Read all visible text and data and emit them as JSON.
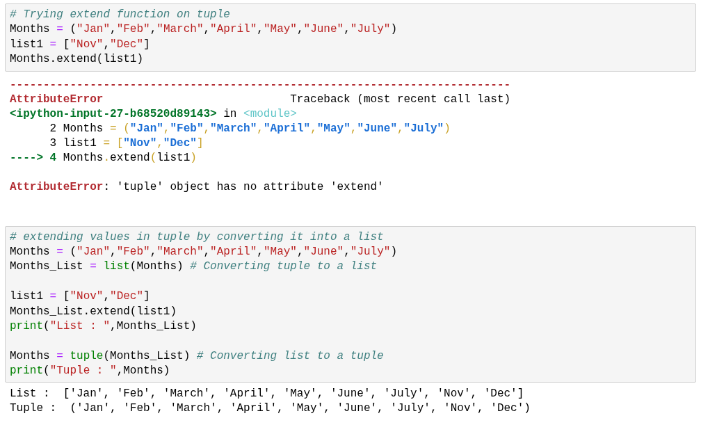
{
  "cells": [
    {
      "kind": "code",
      "lines": [
        {
          "kind": "text",
          "tokens": [
            {
              "kind": "comment",
              "text": "# Trying extend function on tuple"
            }
          ]
        },
        {
          "kind": "text",
          "tokens": [
            {
              "kind": "plain",
              "text": "Months "
            },
            {
              "kind": "operator",
              "text": "="
            },
            {
              "kind": "plain",
              "text": " ("
            },
            {
              "kind": "string",
              "text": "\"Jan\""
            },
            {
              "kind": "plain",
              "text": ","
            },
            {
              "kind": "string",
              "text": "\"Feb\""
            },
            {
              "kind": "plain",
              "text": ","
            },
            {
              "kind": "string",
              "text": "\"March\""
            },
            {
              "kind": "plain",
              "text": ","
            },
            {
              "kind": "string",
              "text": "\"April\""
            },
            {
              "kind": "plain",
              "text": ","
            },
            {
              "kind": "string",
              "text": "\"May\""
            },
            {
              "kind": "plain",
              "text": ","
            },
            {
              "kind": "string",
              "text": "\"June\""
            },
            {
              "kind": "plain",
              "text": ","
            },
            {
              "kind": "string",
              "text": "\"July\""
            },
            {
              "kind": "plain",
              "text": ")"
            }
          ]
        },
        {
          "kind": "text",
          "tokens": [
            {
              "kind": "plain",
              "text": "list1 "
            },
            {
              "kind": "operator",
              "text": "="
            },
            {
              "kind": "plain",
              "text": " ["
            },
            {
              "kind": "string",
              "text": "\"Nov\""
            },
            {
              "kind": "plain",
              "text": ","
            },
            {
              "kind": "string",
              "text": "\"Dec\""
            },
            {
              "kind": "plain",
              "text": "]"
            }
          ]
        },
        {
          "kind": "text",
          "tokens": [
            {
              "kind": "plain",
              "text": "Months.extend(list1)"
            }
          ]
        }
      ]
    },
    {
      "kind": "error",
      "lines": [
        {
          "kind": "text",
          "tokens": [
            {
              "kind": "error-name",
              "text": "---------------------------------------------------------------------------"
            }
          ]
        },
        {
          "kind": "text",
          "tokens": [
            {
              "kind": "error-name",
              "text": "AttributeError"
            },
            {
              "kind": "plain",
              "text": "                            Traceback (most recent call last)"
            }
          ]
        },
        {
          "kind": "text",
          "tokens": [
            {
              "kind": "file",
              "text": "<ipython-input-27-b68520d89143>"
            },
            {
              "kind": "plain",
              "text": " in "
            },
            {
              "kind": "module",
              "text": "<module>"
            }
          ]
        },
        {
          "kind": "text",
          "tokens": [
            {
              "kind": "plain",
              "text": "      2 Months "
            },
            {
              "kind": "tb-punct",
              "text": "= "
            },
            {
              "kind": "tb-punct",
              "text": "("
            },
            {
              "kind": "tb-string",
              "text": "\"Jan\""
            },
            {
              "kind": "tb-punct",
              "text": ","
            },
            {
              "kind": "tb-string",
              "text": "\"Feb\""
            },
            {
              "kind": "tb-punct",
              "text": ","
            },
            {
              "kind": "tb-string",
              "text": "\"March\""
            },
            {
              "kind": "tb-punct",
              "text": ","
            },
            {
              "kind": "tb-string",
              "text": "\"April\""
            },
            {
              "kind": "tb-punct",
              "text": ","
            },
            {
              "kind": "tb-string",
              "text": "\"May\""
            },
            {
              "kind": "tb-punct",
              "text": ","
            },
            {
              "kind": "tb-string",
              "text": "\"June\""
            },
            {
              "kind": "tb-punct",
              "text": ","
            },
            {
              "kind": "tb-string",
              "text": "\"July\""
            },
            {
              "kind": "tb-punct",
              "text": ")"
            }
          ]
        },
        {
          "kind": "text",
          "tokens": [
            {
              "kind": "plain",
              "text": "      3 list1 "
            },
            {
              "kind": "tb-punct",
              "text": "= "
            },
            {
              "kind": "tb-punct",
              "text": "["
            },
            {
              "kind": "tb-string",
              "text": "\"Nov\""
            },
            {
              "kind": "tb-punct",
              "text": ","
            },
            {
              "kind": "tb-string",
              "text": "\"Dec\""
            },
            {
              "kind": "tb-punct",
              "text": "]"
            }
          ]
        },
        {
          "kind": "text",
          "tokens": [
            {
              "kind": "file",
              "text": "----> 4"
            },
            {
              "kind": "plain",
              "text": " Months"
            },
            {
              "kind": "tb-punct",
              "text": "."
            },
            {
              "kind": "plain",
              "text": "extend"
            },
            {
              "kind": "tb-punct",
              "text": "("
            },
            {
              "kind": "plain",
              "text": "list1"
            },
            {
              "kind": "tb-punct",
              "text": ")"
            }
          ]
        },
        {
          "kind": "blank"
        },
        {
          "kind": "text",
          "tokens": [
            {
              "kind": "error-name",
              "text": "AttributeError"
            },
            {
              "kind": "plain",
              "text": ": 'tuple' object has no attribute 'extend'"
            }
          ]
        }
      ]
    },
    {
      "kind": "code",
      "lines": [
        {
          "kind": "text",
          "tokens": [
            {
              "kind": "comment",
              "text": "# extending values in tuple by converting it into a list"
            }
          ]
        },
        {
          "kind": "text",
          "tokens": [
            {
              "kind": "plain",
              "text": "Months "
            },
            {
              "kind": "operator",
              "text": "="
            },
            {
              "kind": "plain",
              "text": " ("
            },
            {
              "kind": "string",
              "text": "\"Jan\""
            },
            {
              "kind": "plain",
              "text": ","
            },
            {
              "kind": "string",
              "text": "\"Feb\""
            },
            {
              "kind": "plain",
              "text": ","
            },
            {
              "kind": "string",
              "text": "\"March\""
            },
            {
              "kind": "plain",
              "text": ","
            },
            {
              "kind": "string",
              "text": "\"April\""
            },
            {
              "kind": "plain",
              "text": ","
            },
            {
              "kind": "string",
              "text": "\"May\""
            },
            {
              "kind": "plain",
              "text": ","
            },
            {
              "kind": "string",
              "text": "\"June\""
            },
            {
              "kind": "plain",
              "text": ","
            },
            {
              "kind": "string",
              "text": "\"July\""
            },
            {
              "kind": "plain",
              "text": ")"
            }
          ]
        },
        {
          "kind": "text",
          "tokens": [
            {
              "kind": "plain",
              "text": "Months_List "
            },
            {
              "kind": "operator",
              "text": "= "
            },
            {
              "kind": "builtin",
              "text": "list"
            },
            {
              "kind": "plain",
              "text": "(Months) "
            },
            {
              "kind": "comment",
              "text": "# Converting tuple to a list"
            }
          ]
        },
        {
          "kind": "blank"
        },
        {
          "kind": "text",
          "tokens": [
            {
              "kind": "plain",
              "text": "list1 "
            },
            {
              "kind": "operator",
              "text": "="
            },
            {
              "kind": "plain",
              "text": " ["
            },
            {
              "kind": "string",
              "text": "\"Nov\""
            },
            {
              "kind": "plain",
              "text": ","
            },
            {
              "kind": "string",
              "text": "\"Dec\""
            },
            {
              "kind": "plain",
              "text": "]"
            }
          ]
        },
        {
          "kind": "text",
          "tokens": [
            {
              "kind": "plain",
              "text": "Months_List.extend(list1)"
            }
          ]
        },
        {
          "kind": "text",
          "tokens": [
            {
              "kind": "builtin",
              "text": "print"
            },
            {
              "kind": "plain",
              "text": "("
            },
            {
              "kind": "string",
              "text": "\"List : \""
            },
            {
              "kind": "plain",
              "text": ",Months_List)"
            }
          ]
        },
        {
          "kind": "blank"
        },
        {
          "kind": "text",
          "tokens": [
            {
              "kind": "plain",
              "text": "Months "
            },
            {
              "kind": "operator",
              "text": "= "
            },
            {
              "kind": "builtin",
              "text": "tuple"
            },
            {
              "kind": "plain",
              "text": "(Months_List) "
            },
            {
              "kind": "comment",
              "text": "# Converting list to a tuple"
            }
          ]
        },
        {
          "kind": "text",
          "tokens": [
            {
              "kind": "builtin",
              "text": "print"
            },
            {
              "kind": "plain",
              "text": "("
            },
            {
              "kind": "string",
              "text": "\"Tuple : \""
            },
            {
              "kind": "plain",
              "text": ",Months)"
            }
          ]
        }
      ]
    },
    {
      "kind": "output",
      "lines": [
        {
          "kind": "text",
          "tokens": [
            {
              "kind": "plain",
              "text": "List :  ['Jan', 'Feb', 'March', 'April', 'May', 'June', 'July', 'Nov', 'Dec']"
            }
          ]
        },
        {
          "kind": "text",
          "tokens": [
            {
              "kind": "plain",
              "text": "Tuple :  ('Jan', 'Feb', 'March', 'April', 'May', 'June', 'July', 'Nov', 'Dec')"
            }
          ]
        }
      ]
    }
  ]
}
